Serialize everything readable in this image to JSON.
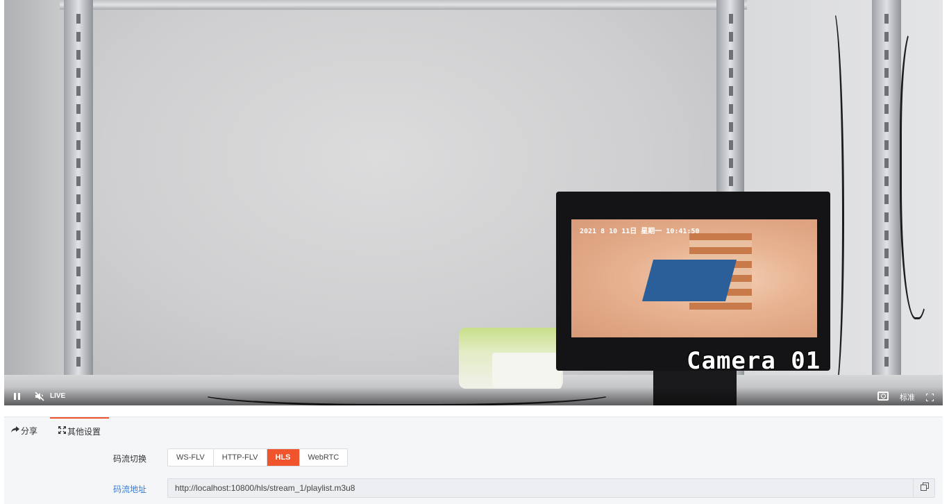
{
  "video": {
    "overlay_label": "Camera 01",
    "monitor_osd": "2021 8 10 11日  星期一  10:41:50",
    "controls": {
      "live_label": "LIVE",
      "quality_label": "标准",
      "icons": [
        "pause-icon",
        "mute-icon",
        "camera-icon",
        "fullscreen-icon"
      ]
    }
  },
  "tabs": [
    {
      "label": "分享",
      "icon": "share-icon"
    },
    {
      "label": "其他设置",
      "icon": "settings-icon",
      "active": true
    }
  ],
  "stream_switch": {
    "label": "码流切换",
    "options": [
      "WS-FLV",
      "HTTP-FLV",
      "HLS",
      "WebRTC"
    ],
    "selected": "HLS"
  },
  "stream_address": {
    "label": "码流地址",
    "value": "http://localhost:10800/hls/stream_1/playlist.m3u8"
  },
  "colors": {
    "accent": "#f0542d",
    "link": "#3a7bd5",
    "panel_bg": "#f4f6f8"
  }
}
